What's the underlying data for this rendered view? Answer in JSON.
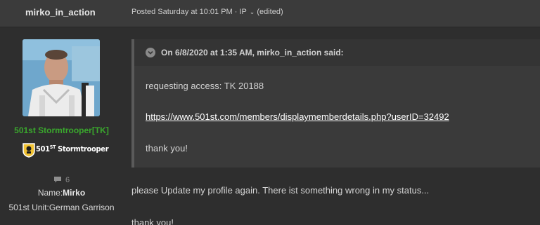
{
  "post": {
    "author": "mirko_in_action",
    "meta_prefix": "Posted Saturday at 10:01 PM · IP",
    "meta_suffix": "(edited)",
    "caret_icon": "chevron-down-icon"
  },
  "profile": {
    "rank": "501st Stormtrooper[TK]",
    "badge_prefix": "501",
    "badge_sup": "ST",
    "badge_suffix": " Stormtrooper",
    "comment_count": "6",
    "name_label": "Name:",
    "name_value": "Mirko",
    "unit_label": "501st Unit:",
    "unit_value": "German Garrison",
    "colors": {
      "rank": "#3aa82d"
    }
  },
  "quote": {
    "title": "On 6/8/2020 at 1:35 AM, mirko_in_action said:",
    "line1": "requesting access: TK 20188",
    "link": "https://www.501st.com/members/displaymemberdetails.php?userID=32492",
    "line3": "thank you!"
  },
  "body": {
    "line1": "please Update my profile again. There ist something wrong in my status...",
    "line2": "thank you!"
  }
}
